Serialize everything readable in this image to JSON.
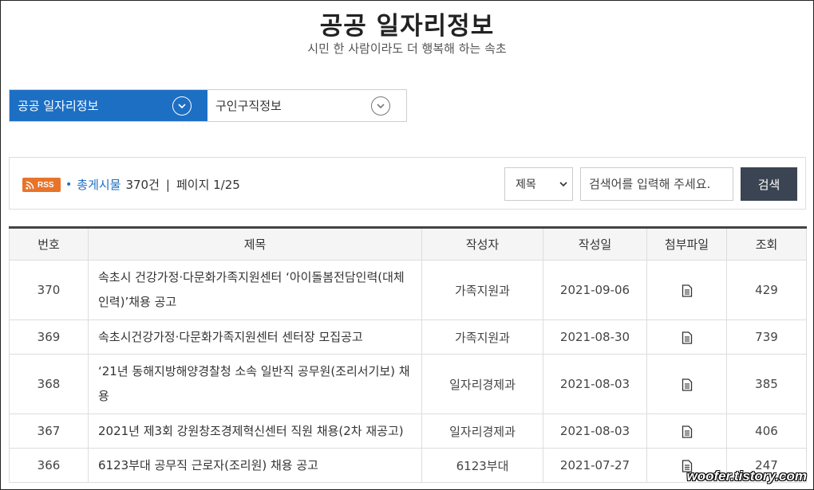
{
  "header": {
    "title": "공공 일자리정보",
    "subtitle": "시민 한 사람이라도 더 행복해 하는 속초"
  },
  "menu": {
    "items": [
      {
        "label": "공공 일자리정보",
        "active": true
      },
      {
        "label": "구인구직정보",
        "active": false
      }
    ]
  },
  "toolbar": {
    "rss_label": "RSS",
    "total_label": "총게시물",
    "total_count": "370건",
    "page_label": "페이지 1/25",
    "search_field_selected": "제목",
    "search_placeholder": "검색어를 입력해 주세요.",
    "search_button": "검색"
  },
  "table": {
    "columns": [
      "번호",
      "제목",
      "작성자",
      "작성일",
      "첨부파일",
      "조회"
    ],
    "rows": [
      {
        "num": "370",
        "title": "속초시 건강가정·다문화가족지원센터 ‘아이돌봄전담인력(대체인력)’채용 공고",
        "author": "가족지원과",
        "date": "2021-09-06",
        "views": "429"
      },
      {
        "num": "369",
        "title": "속초시건강가정·다문화가족지원센터 센터장 모집공고",
        "author": "가족지원과",
        "date": "2021-08-30",
        "views": "739"
      },
      {
        "num": "368",
        "title": "‘21년 동해지방해양경찰청 소속 일반직 공무원(조리서기보) 채용",
        "author": "일자리경제과",
        "date": "2021-08-03",
        "views": "385"
      },
      {
        "num": "367",
        "title": "2021년 제3회 강원창조경제혁신센터 직원 채용(2차 재공고)",
        "author": "일자리경제과",
        "date": "2021-08-03",
        "views": "406"
      },
      {
        "num": "366",
        "title": "6123부대 공무직 근로자(조리원) 채용 공고",
        "author": "6123부대",
        "date": "2021-07-27",
        "views": "247"
      }
    ]
  },
  "watermark": "woofer.tistory.com",
  "colors": {
    "accent": "#1d6fc4",
    "rss": "#e8742a",
    "search_button": "#3a4452"
  }
}
